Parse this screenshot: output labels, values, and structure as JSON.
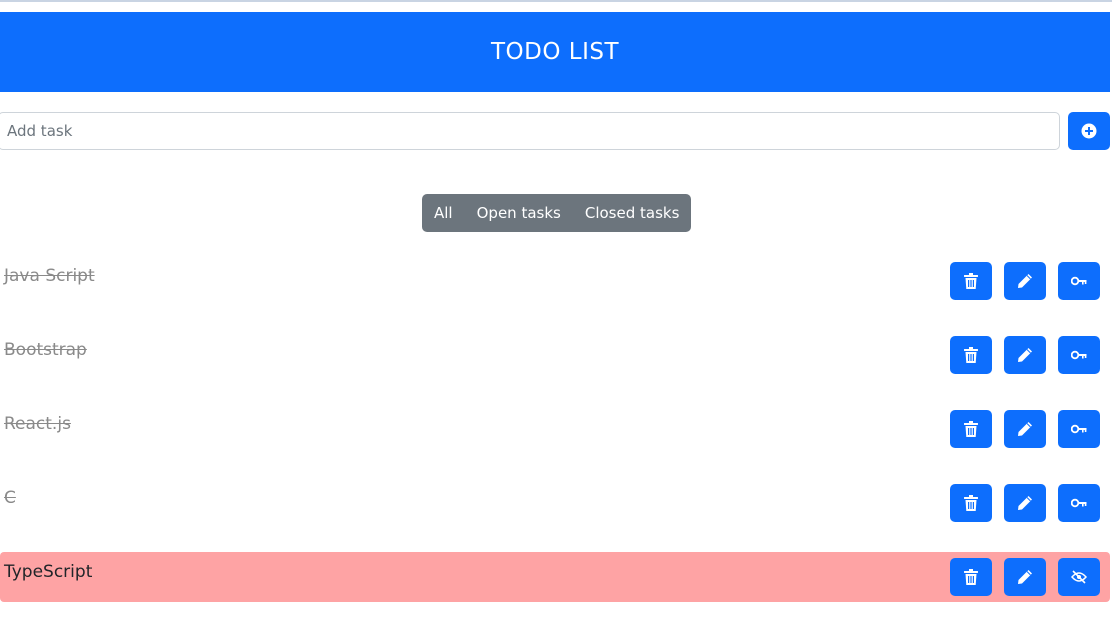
{
  "header": {
    "title": "TODO LIST"
  },
  "add_task": {
    "placeholder": "Add task",
    "value": ""
  },
  "filters": [
    {
      "label": "All"
    },
    {
      "label": "Open tasks"
    },
    {
      "label": "Closed tasks"
    }
  ],
  "tasks": [
    {
      "text": "Java Script",
      "completed": true
    },
    {
      "text": "Bootstrap",
      "completed": true
    },
    {
      "text": "React.js",
      "completed": true
    },
    {
      "text": "C",
      "completed": true
    },
    {
      "text": "TypeScript",
      "completed": false
    }
  ],
  "colors": {
    "primary": "#0d6efd",
    "secondary": "#6c757d",
    "open_row": "#fea3a4",
    "done_text": "#8a8a8a"
  },
  "icons": {
    "add": "plus-circle-icon",
    "delete": "trash-icon",
    "edit": "pencil-icon",
    "toggle_done": "key-icon",
    "toggle_open": "eye-slash-icon"
  }
}
